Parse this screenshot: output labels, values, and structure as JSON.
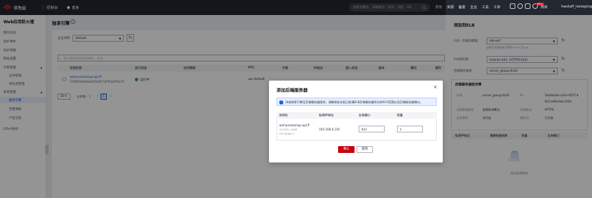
{
  "topbar": {
    "brand": "华为云",
    "console": "控制台",
    "region": "香港",
    "search_placeholder": "搜索云服务、快捷操作、资源、文档、API",
    "nav": [
      "费用",
      "资源",
      "备案",
      "企业",
      "工具",
      "工单"
    ],
    "badge": "99+",
    "lang": "简体",
    "user": "hwstaff_noiseping"
  },
  "sidebar": {
    "title": "Web应用防火墙",
    "items": [
      {
        "label": "服务总览",
        "type": "item"
      },
      {
        "label": "防护事件",
        "type": "item"
      },
      {
        "label": "防护策略",
        "type": "item"
      },
      {
        "label": "网站设置",
        "type": "item"
      },
      {
        "label": "对象管理",
        "type": "group"
      },
      {
        "label": "证书管理",
        "type": "child"
      },
      {
        "label": "地址组管理",
        "type": "child"
      },
      {
        "label": "系统管理",
        "type": "group"
      },
      {
        "label": "独享引擎",
        "type": "child-active"
      },
      {
        "label": "告警通知",
        "type": "child"
      },
      {
        "label": "产品信息",
        "type": "child"
      },
      {
        "label": "DDoS防护",
        "type": "item"
      }
    ]
  },
  "main": {
    "title": "独享引擎",
    "project_label": "企业项目",
    "project_value": "default",
    "filter_placeholder": "默认按照实例名称搜索、过滤",
    "columns": [
      "实例名称",
      "运行状态",
      "访问网络",
      "VPC",
      "子网",
      "IP地址",
      "接入状态",
      "版本",
      "模式",
      "操作"
    ],
    "row": {
      "name": "waf-prestashop-apCP",
      "id": "5196458d0eb6a4f3af9c782f5ad87bc35",
      "status": "运行中",
      "network": "",
      "vpc": "vpc-default"
    },
    "pager": {
      "size": "10",
      "total": "总条数：1",
      "prev": "<",
      "page": "1",
      "next": ">"
    }
  },
  "drawer": {
    "title": "添加到ELB",
    "elb_label": "ELB（负载均衡器）",
    "elb_value": "elb-waf",
    "elb_note": "选择可关联独享引擎同一VPC下ELB。",
    "listener_label": "ELB监听器",
    "listener_value": "listener-443（HTTPS:443）",
    "group_label": "后端服务器组",
    "group_value": "server_group-6c02",
    "section_title": "后端服务器组详情",
    "details": [
      {
        "k": "名称",
        "v": "server_group-6c02"
      },
      {
        "k": "ID",
        "v": "5ba0ba0e-a31e-4557-b"
      },
      {
        "k": "",
        "v": "8c5-a4fa4abc140e"
      },
      {
        "k": "分配策略类型",
        "v": "加权轮询算法"
      },
      {
        "k": "后端协议",
        "v": "HTTPS"
      },
      {
        "k": "会话保持",
        "v": "未开启"
      },
      {
        "k": "慢启动",
        "v": "已开启"
      }
    ],
    "table_cols": [
      "私网IP地址",
      "健康检查结果",
      "权重",
      "业务端口"
    ],
    "empty": "暂无表格数据"
  },
  "modal": {
    "title": "添加后端服务器",
    "info": "添加独享引擎至后端服务器组时，请确保安全组已放通ELB后端服务器所在的SCA范围以及后端服务器端口。",
    "columns": [
      "实例名",
      "私网IP地址",
      "业务端口",
      "权重"
    ],
    "row": {
      "name": "waf-prestashop-apCP",
      "spec": "2vCPUs | 8GB",
      "spec2": "s7n.large.4",
      "ip": "192.168.0.145",
      "port": "443",
      "weight": "1"
    },
    "ok": "确认",
    "cancel": "取消"
  },
  "colors": {
    "topbar": "#23272f",
    "accent": "#0d56d8",
    "danger": "#c7000b",
    "success": "#20a64d"
  }
}
